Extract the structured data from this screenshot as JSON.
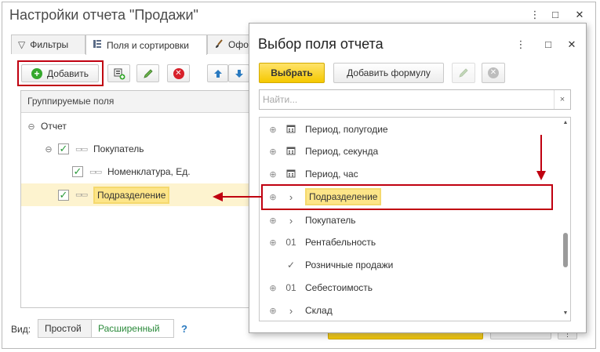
{
  "main_window": {
    "title": "Настройки отчета \"Продажи\"",
    "controls": {
      "more": "⋮",
      "minimize": "□",
      "close": "✕"
    },
    "tabs": [
      {
        "label": "Фильтры",
        "icon": "filter-icon"
      },
      {
        "label": "Поля и сортировки",
        "icon": "fields-icon"
      },
      {
        "label": "Офо",
        "icon": "brush-icon"
      }
    ],
    "toolbar": {
      "add_label": "Добавить"
    },
    "grid": {
      "header": "Группируемые поля",
      "rows": [
        {
          "label": "Отчет",
          "expander": "⊖",
          "checked": false
        },
        {
          "label": "Покупатель",
          "expander": "⊖",
          "checked": true
        },
        {
          "label": "Номенклатура, Ед.",
          "expander": "",
          "checked": true
        },
        {
          "label": "Подразделение",
          "expander": "",
          "checked": true,
          "highlighted": true
        }
      ]
    },
    "view": {
      "label": "Вид:",
      "options": [
        {
          "label": "Простой",
          "selected": false
        },
        {
          "label": "Расширенный",
          "selected": true
        }
      ],
      "help": "?"
    }
  },
  "dialog": {
    "title": "Выбор поля отчета",
    "controls": {
      "more": "⋮",
      "minimize": "□",
      "close": "✕"
    },
    "toolbar": {
      "select_label": "Выбрать",
      "add_formula_label": "Добавить формулу"
    },
    "search": {
      "placeholder": "Найти...",
      "clear": "×"
    },
    "items": [
      {
        "label": "Период, полугодие",
        "expander": "⊕",
        "type_icon": "calendar-icon"
      },
      {
        "label": "Период, секунда",
        "expander": "⊕",
        "type_icon": "calendar-icon"
      },
      {
        "label": "Период, час",
        "expander": "⊕",
        "type_icon": "calendar-icon"
      },
      {
        "label": "Подразделение",
        "expander": "⊕",
        "type_icon": "reference-icon",
        "highlighted": true
      },
      {
        "label": "Покупатель",
        "expander": "⊕",
        "type_icon": "reference-icon"
      },
      {
        "label": "Рентабельность",
        "expander": "⊕",
        "type_icon": "number-icon",
        "type_text": "01"
      },
      {
        "label": "Розничные продажи",
        "expander": "",
        "type_icon": "boolean-icon"
      },
      {
        "label": "Себестоимость",
        "expander": "⊕",
        "type_icon": "number-icon",
        "type_text": "01"
      },
      {
        "label": "Склад",
        "expander": "⊕",
        "type_icon": "reference-icon"
      }
    ]
  },
  "colors": {
    "accent_yellow": "#f5c800",
    "highlight": "#fde588",
    "annotation_red": "#c00010",
    "check_green": "#2a9a3a"
  }
}
